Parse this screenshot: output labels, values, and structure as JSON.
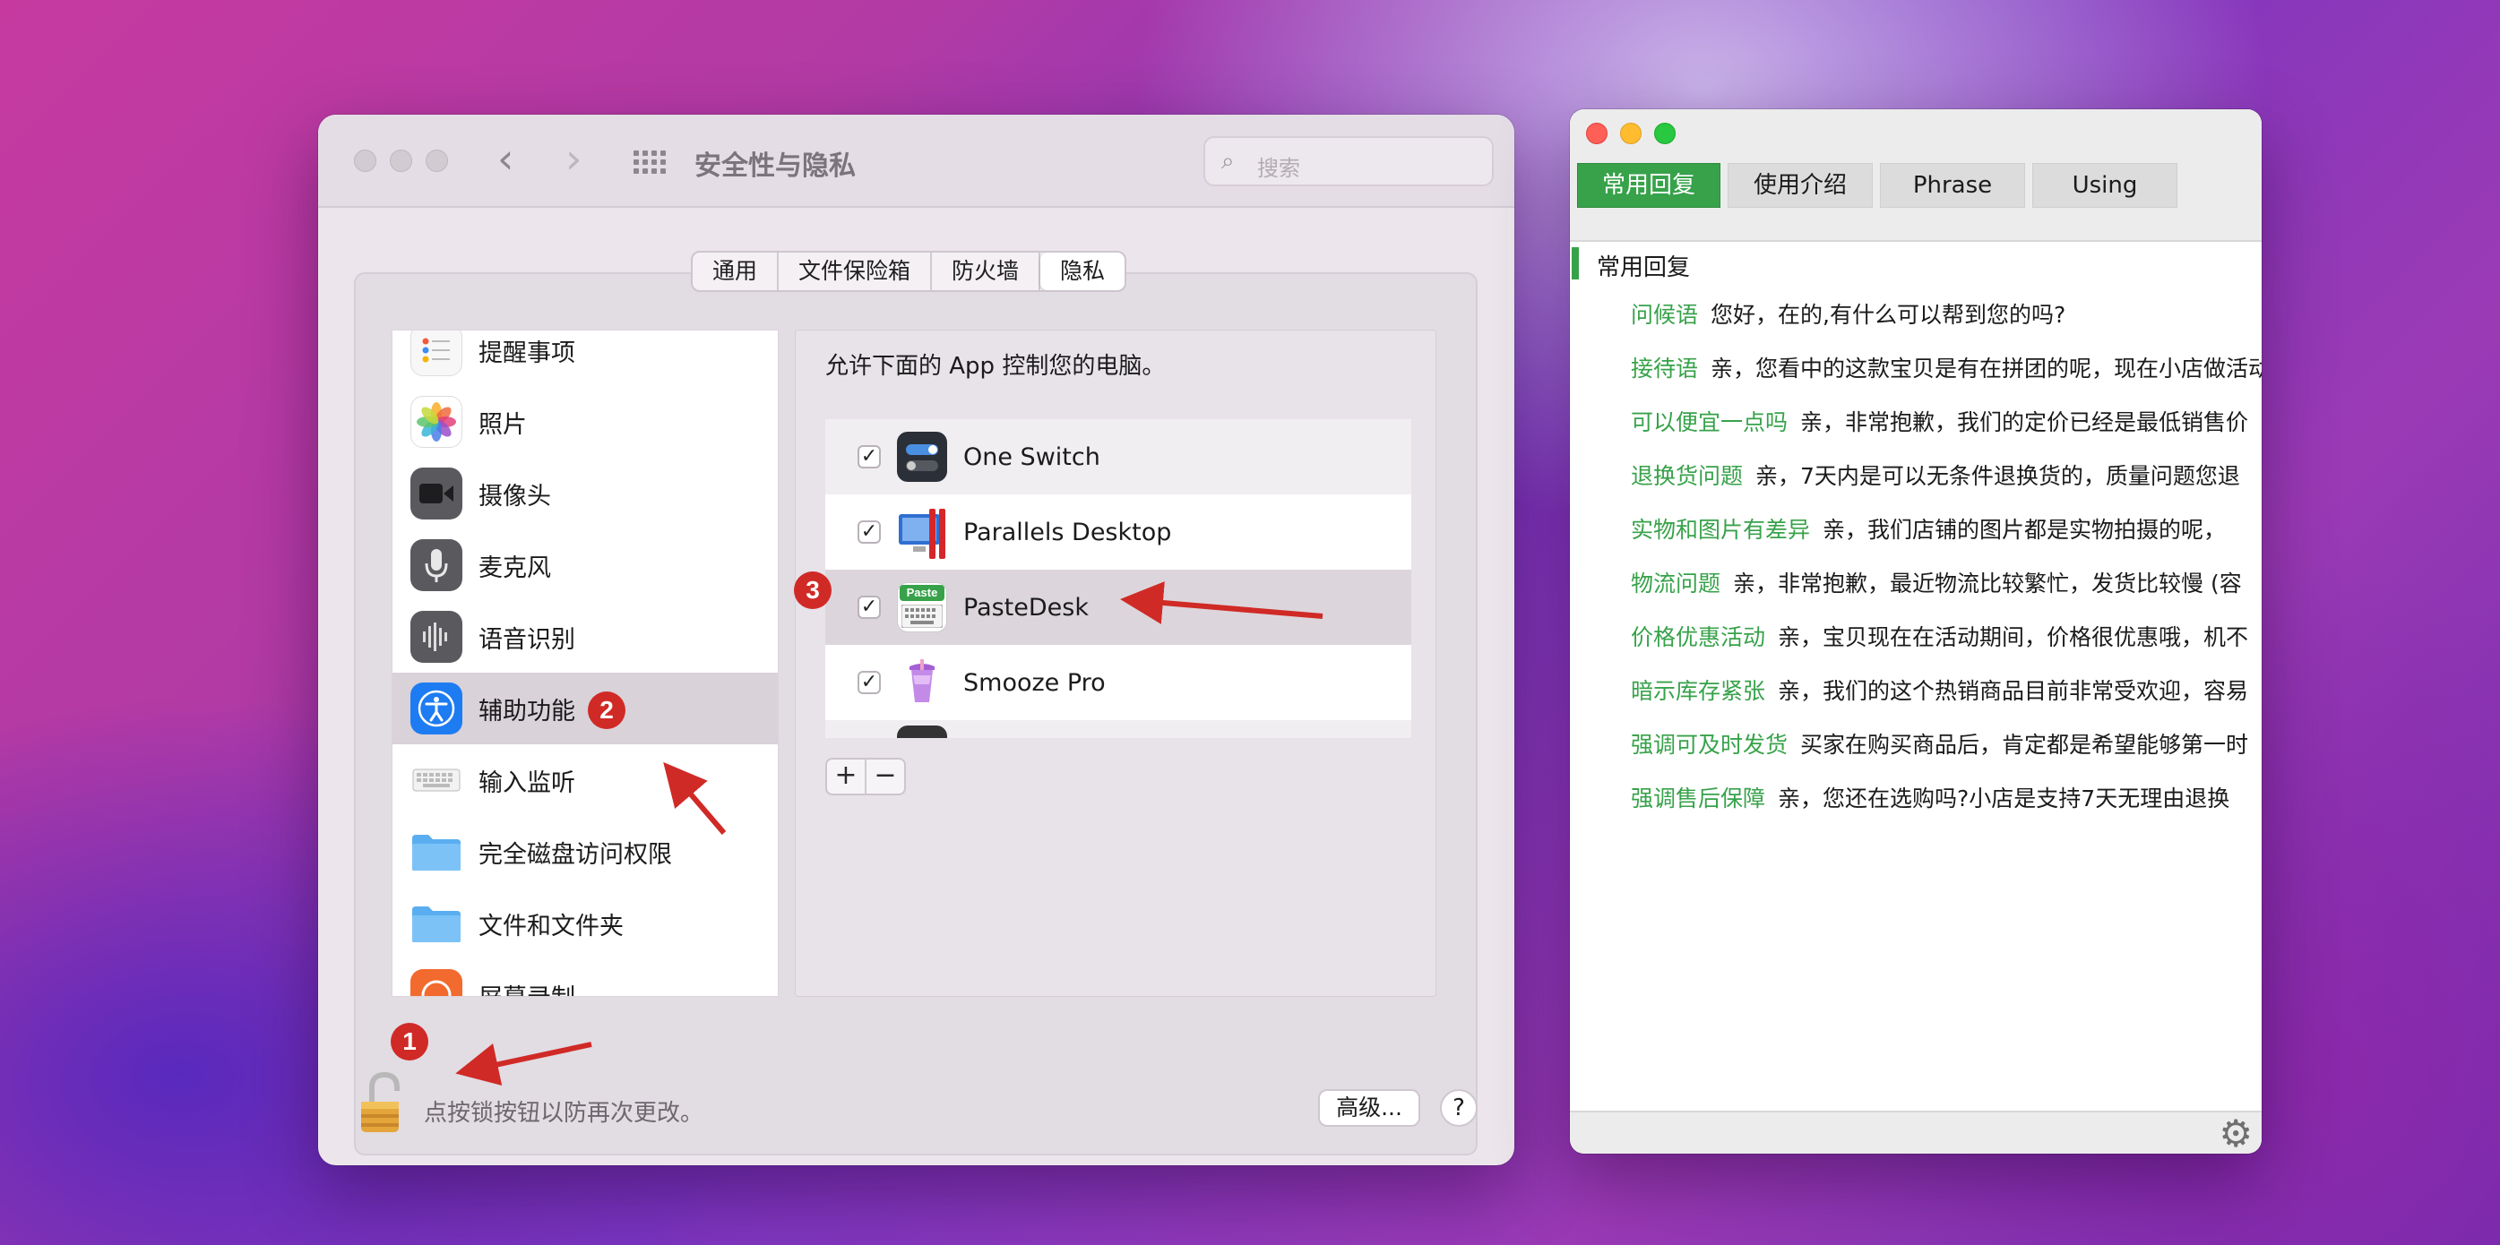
{
  "prefs_window": {
    "title": "安全性与隐私",
    "search_placeholder": "搜索",
    "tabs": [
      {
        "label": "通用",
        "active": false
      },
      {
        "label": "文件保险箱",
        "active": false
      },
      {
        "label": "防火墙",
        "active": false
      },
      {
        "label": "隐私",
        "active": true
      }
    ],
    "sidebar_items": [
      {
        "label": "提醒事项",
        "icon": "reminders-icon"
      },
      {
        "label": "照片",
        "icon": "photos-icon"
      },
      {
        "label": "摄像头",
        "icon": "camera-icon"
      },
      {
        "label": "麦克风",
        "icon": "microphone-icon"
      },
      {
        "label": "语音识别",
        "icon": "speech-recognition-icon"
      },
      {
        "label": "辅助功能",
        "icon": "accessibility-icon",
        "selected": true
      },
      {
        "label": "输入监听",
        "icon": "keyboard-icon"
      },
      {
        "label": "完全磁盘访问权限",
        "icon": "folder-icon"
      },
      {
        "label": "文件和文件夹",
        "icon": "folder-icon"
      },
      {
        "label": "屏幕录制",
        "icon": "screen-recording-icon"
      }
    ],
    "allow_text": "允许下面的 App 控制您的电脑。",
    "apps": [
      {
        "name": "One Switch",
        "checked": true
      },
      {
        "name": "Parallels Desktop",
        "checked": true
      },
      {
        "name": "PasteDesk",
        "checked": true,
        "icon_text": "Paste"
      },
      {
        "name": "Smooze Pro",
        "checked": true
      }
    ],
    "add_label": "+",
    "remove_label": "−",
    "lock_text": "点按锁按钮以防再次更改。",
    "advanced_label": "高级...",
    "help_label": "?"
  },
  "pastedesk_window": {
    "tabs": [
      {
        "label": "常用回复",
        "active": true
      },
      {
        "label": "使用介绍",
        "active": false
      },
      {
        "label": "Phrase",
        "active": false
      },
      {
        "label": "Using",
        "active": false
      }
    ],
    "group_title": "常用回复",
    "phrases": [
      {
        "key": "问候语",
        "text": "您好，在的,有什么可以帮到您的吗?"
      },
      {
        "key": "接待语",
        "text": "亲，您看中的这款宝贝是有在拼团的呢，现在小店做活动"
      },
      {
        "key": "可以便宜一点吗",
        "text": "亲，非常抱歉，我们的定价已经是最低销售价"
      },
      {
        "key": "退换货问题",
        "text": "亲，7天内是可以无条件退换货的，质量问题您退"
      },
      {
        "key": "实物和图片有差异",
        "text": "亲，我们店铺的图片都是实物拍摄的呢，"
      },
      {
        "key": "物流问题",
        "text": "亲，非常抱歉，最近物流比较繁忙，发货比较慢 (容"
      },
      {
        "key": "价格优惠活动",
        "text": "亲，宝贝现在在活动期间，价格很优惠哦，机不"
      },
      {
        "key": "暗示库存紧张",
        "text": "亲，我们的这个热销商品目前非常受欢迎，容易"
      },
      {
        "key": "强调可及时发货",
        "text": "买家在购买商品后，肯定都是希望能够第一时"
      },
      {
        "key": "强调售后保障",
        "text": "亲，您还在选购吗?小店是支持7天无理由退换"
      }
    ]
  },
  "annotations": [
    "1",
    "2",
    "3"
  ],
  "colors": {
    "pastedesk_green": "#37a24a",
    "annotation_red": "#d02a26",
    "selection_gray": "#d9d2d9"
  }
}
